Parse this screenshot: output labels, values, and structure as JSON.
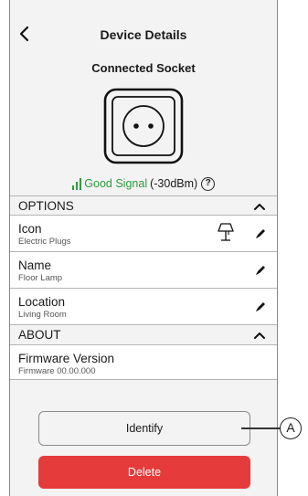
{
  "header": {
    "title": "Device Details",
    "back_icon": "chevron-left-icon"
  },
  "device": {
    "name": "Connected Socket",
    "icon": "socket-icon"
  },
  "signal": {
    "status": "Good Signal",
    "strength": "(-30dBm)",
    "help_glyph": "?",
    "color": "#2e9a3d"
  },
  "options": {
    "header": "OPTIONS",
    "rows": [
      {
        "label": "Icon",
        "value": "Electric Plugs",
        "preview_icon": "floor-lamp-icon"
      },
      {
        "label": "Name",
        "value": "Floor Lamp"
      },
      {
        "label": "Location",
        "value": "Living Room"
      }
    ]
  },
  "about": {
    "header": "ABOUT",
    "firmware_label": "Firmware Version",
    "firmware_value": "Firmware 00.00.000"
  },
  "actions": {
    "identify_label": "Identify",
    "delete_label": "Delete",
    "delete_color": "#e63b3b"
  },
  "callout": {
    "label": "A"
  }
}
